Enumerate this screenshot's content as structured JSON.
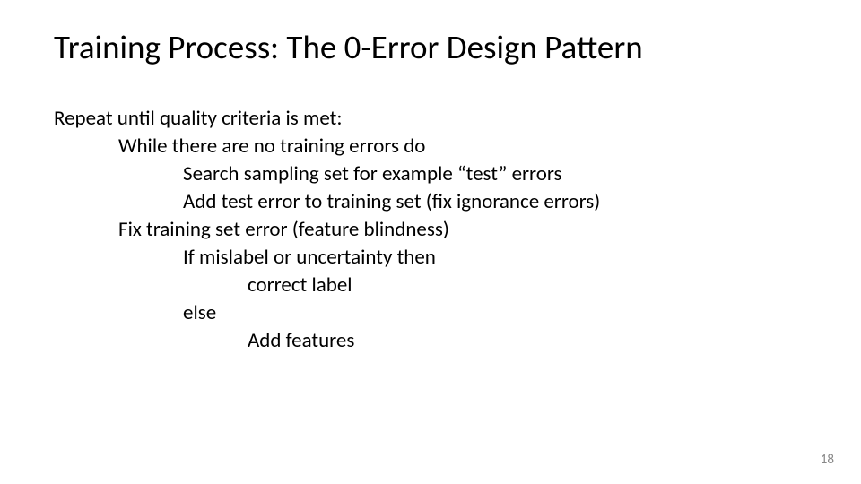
{
  "title": "Training Process: The 0-Error Design Pattern",
  "lines": {
    "l0": "Repeat until quality criteria is met:",
    "l1": "While there are no training errors do",
    "l2": "Search sampling set for example “test” errors",
    "l3": "Add test error to training set (fix ignorance errors)",
    "l4": "Fix training set error (feature blindness)",
    "l5": "If mislabel or uncertainty then",
    "l6": "correct label",
    "l7": "else",
    "l8": "Add features"
  },
  "page_number": "18"
}
